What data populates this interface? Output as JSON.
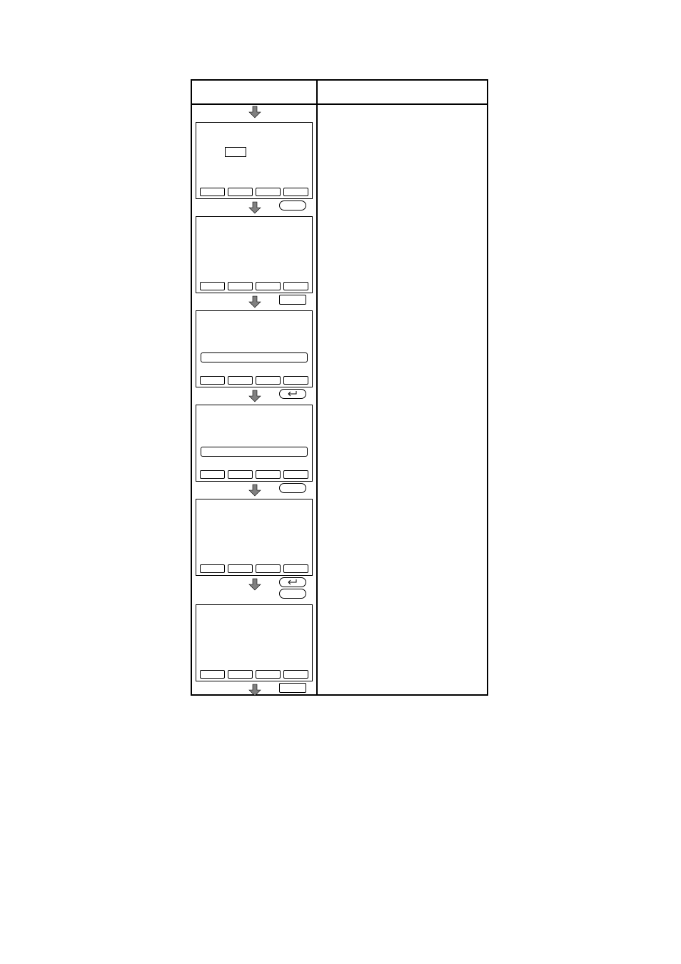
{
  "columns": {
    "left_header": "",
    "right_header": ""
  },
  "steps": [
    {
      "has_indicator": true,
      "has_longfield": false,
      "action_style": "rounded",
      "action_icon": "none",
      "action_count": 1
    },
    {
      "has_indicator": false,
      "has_longfield": false,
      "action_style": "square",
      "action_icon": "none",
      "action_count": 1
    },
    {
      "has_indicator": false,
      "has_longfield": true,
      "action_style": "rounded",
      "action_icon": "enter",
      "action_count": 1
    },
    {
      "has_indicator": false,
      "has_longfield": true,
      "action_style": "rounded",
      "action_icon": "none",
      "action_count": 1
    },
    {
      "has_indicator": false,
      "has_longfield": false,
      "action_style": "rounded",
      "action_icon": "enter",
      "action_count": 2
    },
    {
      "has_indicator": false,
      "has_longfield": false,
      "action_style": "square",
      "action_icon": "none",
      "action_count": 1
    }
  ]
}
